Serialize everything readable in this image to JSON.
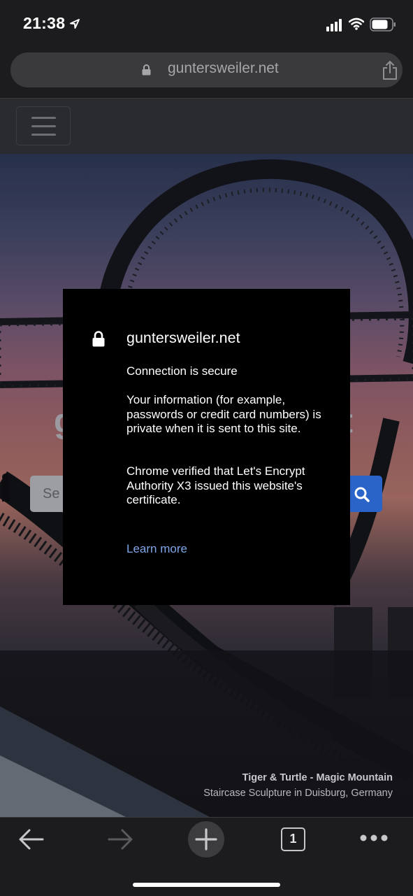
{
  "status_bar": {
    "time": "21:38",
    "icons": [
      "location-arrow-icon",
      "cellular-signal-icon",
      "wifi-icon",
      "battery-icon"
    ]
  },
  "url_bar": {
    "url": "guntersweiler.net",
    "icons": [
      "lock-icon",
      "share-icon"
    ]
  },
  "site_nav": {
    "icons": [
      "hamburger-menu-icon"
    ]
  },
  "hero": {
    "title_left": "g",
    "title_right": "t",
    "search_placeholder": "Se",
    "caption_title": "Tiger & Turtle - Magic Mountain",
    "caption_sub": "Staircase Sculpture in Duisburg, Germany"
  },
  "site_info_dialog": {
    "domain": "guntersweiler.net",
    "status": "Connection is secure",
    "info": "Your information (for example, passwords or credit card numbers) is private when it is sent to this site.",
    "verified": "Chrome verified that Let's Encrypt Authority X3 issued this website's certificate.",
    "learn_more": "Learn more"
  },
  "toolbar": {
    "tab_count": "1",
    "icons": [
      "back-arrow-icon",
      "forward-arrow-icon",
      "plus-icon",
      "tab-count-icon",
      "more-dots-icon"
    ]
  },
  "colors": {
    "chrome_bar": "#1c1c1e",
    "dialog_bg": "#000000",
    "link_blue": "#7fa6e8",
    "search_button": "#2a64c8"
  }
}
